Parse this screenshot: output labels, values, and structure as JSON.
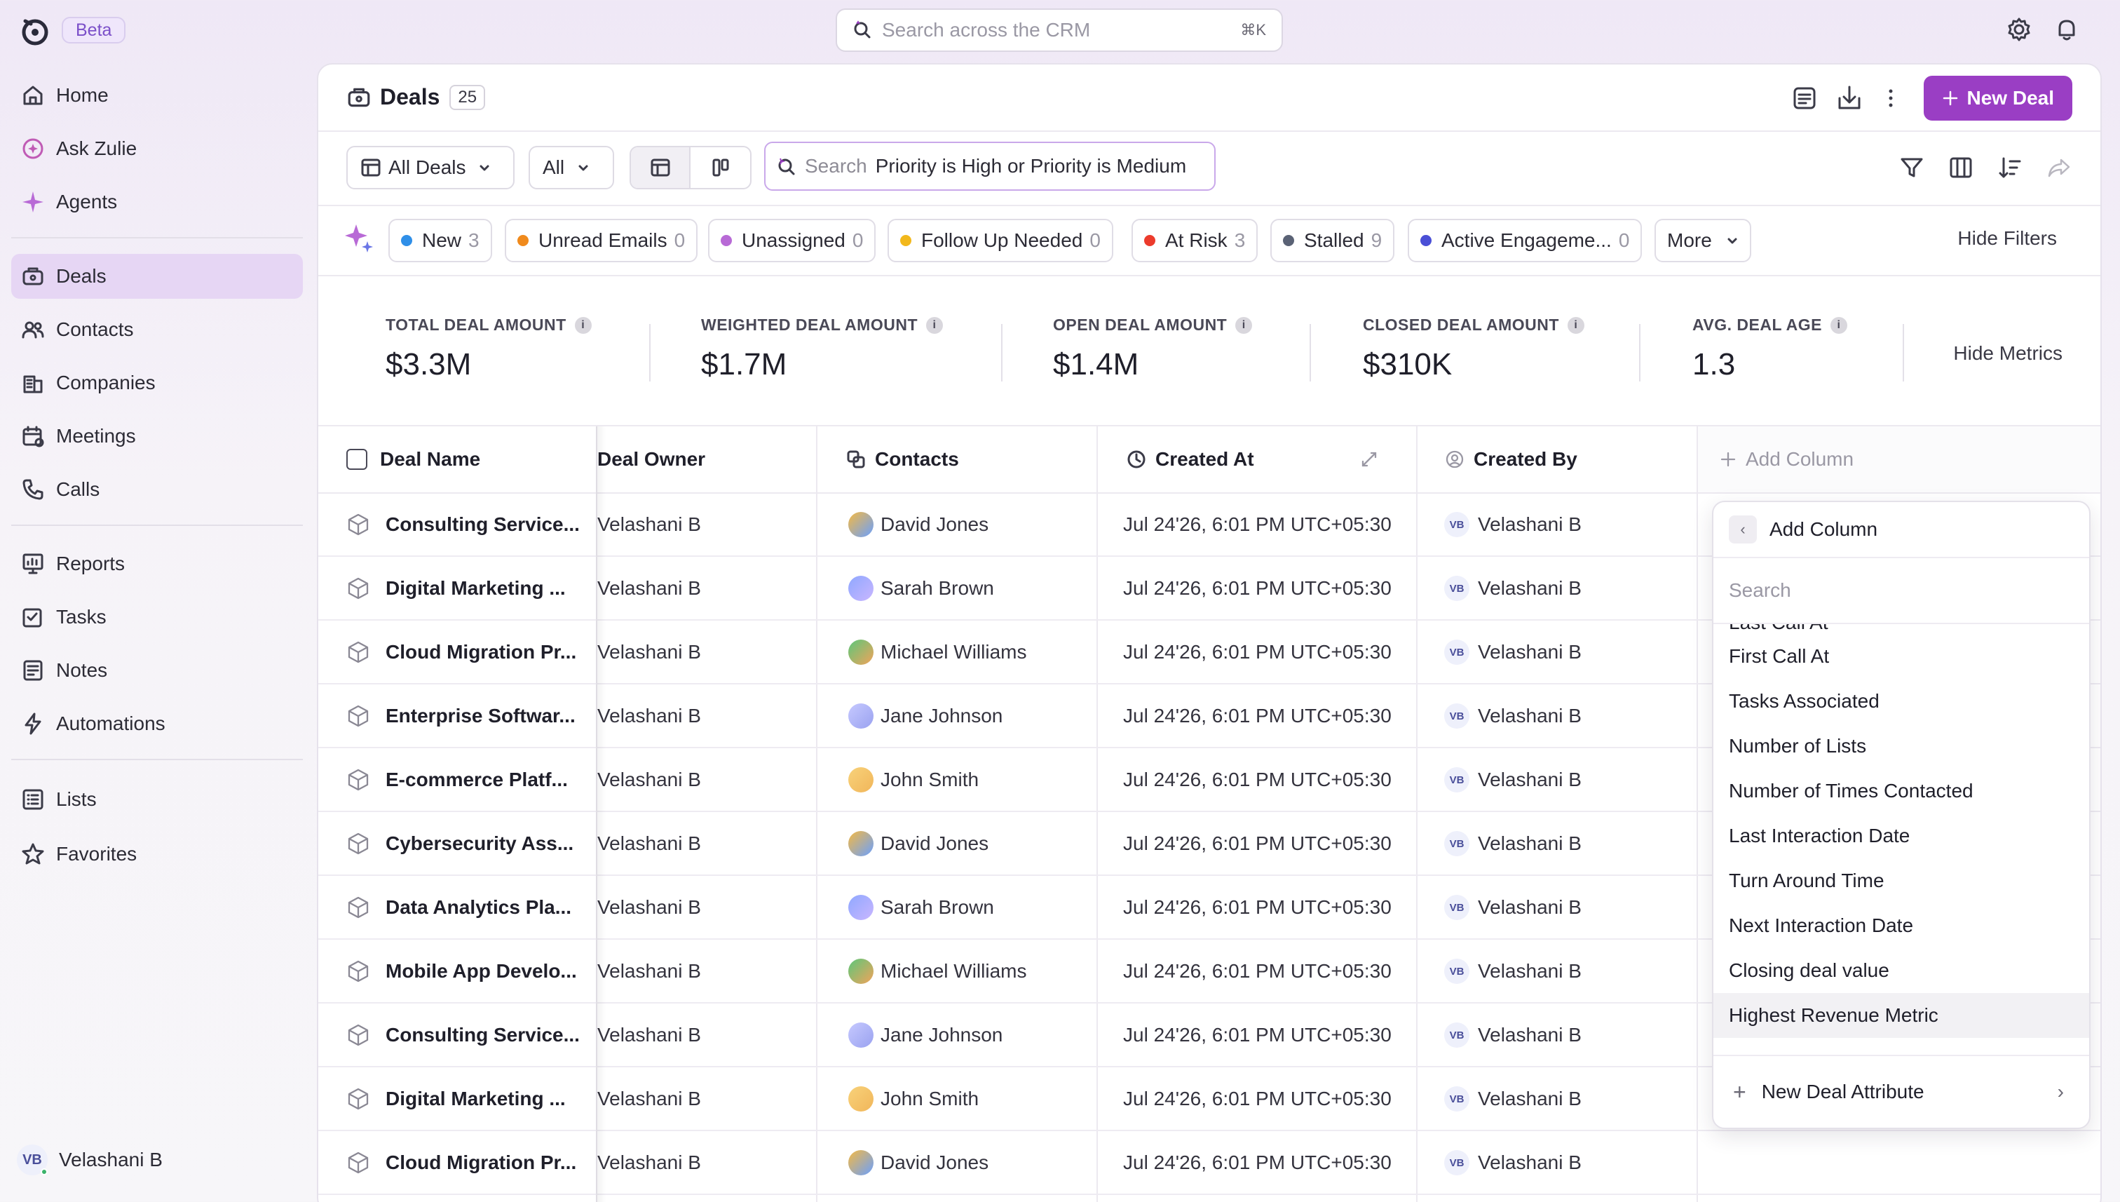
{
  "app": {
    "beta_badge": "Beta",
    "search_placeholder": "Search across the CRM",
    "search_shortcut": "⌘K"
  },
  "sidebar": {
    "items": [
      {
        "label": "Home",
        "icon": "home-icon"
      },
      {
        "label": "Ask Zulie",
        "icon": "ask-zulie-icon"
      },
      {
        "label": "Agents",
        "icon": "sparkle-icon"
      },
      {
        "label": "Deals",
        "icon": "deals-icon"
      },
      {
        "label": "Contacts",
        "icon": "contacts-icon"
      },
      {
        "label": "Companies",
        "icon": "building-icon"
      },
      {
        "label": "Meetings",
        "icon": "calendar-icon"
      },
      {
        "label": "Calls",
        "icon": "phone-icon"
      },
      {
        "label": "Reports",
        "icon": "report-icon"
      },
      {
        "label": "Tasks",
        "icon": "tasks-icon"
      },
      {
        "label": "Notes",
        "icon": "notes-icon"
      },
      {
        "label": "Automations",
        "icon": "bolt-icon"
      },
      {
        "label": "Lists",
        "icon": "list-icon"
      },
      {
        "label": "Favorites",
        "icon": "star-icon"
      }
    ],
    "active": "Deals",
    "user": {
      "initials": "VB",
      "name": "Velashani B"
    }
  },
  "header": {
    "title": "Deals",
    "count": "25",
    "new_deal_label": "New Deal"
  },
  "toolbar": {
    "view_select": "All Deals",
    "scope_select": "All",
    "search_label": "Search",
    "search_query": "Priority is High or Priority is Medium"
  },
  "chips": [
    {
      "label": "New",
      "count": "3",
      "color": "#2f8fe8"
    },
    {
      "label": "Unread Emails",
      "count": "0",
      "color": "#f08a1c"
    },
    {
      "label": "Unassigned",
      "count": "0",
      "color": "#b86ad6"
    },
    {
      "label": "Follow Up Needed",
      "count": "0",
      "color": "#f2b81c"
    },
    {
      "label": "At Risk",
      "count": "3",
      "color": "#ec3b2c"
    },
    {
      "label": "Stalled",
      "count": "9",
      "color": "#5a6275"
    },
    {
      "label": "Active Engageme...",
      "count": "0",
      "color": "#4a4fd6"
    }
  ],
  "more_label": "More",
  "hide_filters_label": "Hide Filters",
  "metrics": [
    {
      "label": "TOTAL DEAL AMOUNT",
      "value": "$3.3M"
    },
    {
      "label": "WEIGHTED DEAL AMOUNT",
      "value": "$1.7M"
    },
    {
      "label": "OPEN DEAL AMOUNT",
      "value": "$1.4M"
    },
    {
      "label": "CLOSED DEAL AMOUNT",
      "value": "$310K"
    },
    {
      "label": "AVG. DEAL AGE",
      "value": "1.3"
    }
  ],
  "hide_metrics_label": "Hide Metrics",
  "table": {
    "columns": [
      "Deal Name",
      "Deal Owner",
      "Contacts",
      "Created At",
      "Created By"
    ],
    "add_column_label": "Add Column",
    "rows": [
      {
        "name": "Consulting Service...",
        "owner": "Velashani B",
        "contact": "David Jones",
        "created_at": "Jul 24'26, 6:01 PM UTC+05:30",
        "created_by": "Velashani B"
      },
      {
        "name": "Digital Marketing ...",
        "owner": "Velashani B",
        "contact": "Sarah Brown",
        "created_at": "Jul 24'26, 6:01 PM UTC+05:30",
        "created_by": "Velashani B"
      },
      {
        "name": "Cloud Migration Pr...",
        "owner": "Velashani B",
        "contact": "Michael Williams",
        "created_at": "Jul 24'26, 6:01 PM UTC+05:30",
        "created_by": "Velashani B"
      },
      {
        "name": "Enterprise Softwar...",
        "owner": "Velashani B",
        "contact": "Jane Johnson",
        "created_at": "Jul 24'26, 6:01 PM UTC+05:30",
        "created_by": "Velashani B"
      },
      {
        "name": "E-commerce Platf...",
        "owner": "Velashani B",
        "contact": "John Smith",
        "created_at": "Jul 24'26, 6:01 PM UTC+05:30",
        "created_by": "Velashani B"
      },
      {
        "name": "Cybersecurity Ass...",
        "owner": "Velashani B",
        "contact": "David Jones",
        "created_at": "Jul 24'26, 6:01 PM UTC+05:30",
        "created_by": "Velashani B"
      },
      {
        "name": "Data Analytics Pla...",
        "owner": "Velashani B",
        "contact": "Sarah Brown",
        "created_at": "Jul 24'26, 6:01 PM UTC+05:30",
        "created_by": "Velashani B"
      },
      {
        "name": "Mobile App Develo...",
        "owner": "Velashani B",
        "contact": "Michael Williams",
        "created_at": "Jul 24'26, 6:01 PM UTC+05:30",
        "created_by": "Velashani B"
      },
      {
        "name": "Consulting Service...",
        "owner": "Velashani B",
        "contact": "Jane Johnson",
        "created_at": "Jul 24'26, 6:01 PM UTC+05:30",
        "created_by": "Velashani B"
      },
      {
        "name": "Digital Marketing ...",
        "owner": "Velashani B",
        "contact": "John Smith",
        "created_at": "Jul 24'26, 6:01 PM UTC+05:30",
        "created_by": "Velashani B"
      },
      {
        "name": "Cloud Migration Pr...",
        "owner": "Velashani B",
        "contact": "David Jones",
        "created_at": "Jul 24'26, 6:01 PM UTC+05:30",
        "created_by": "Velashani B"
      }
    ],
    "initials": "VB"
  },
  "add_column_popover": {
    "title": "Add Column",
    "search_placeholder": "Search",
    "cut_item": "Last Call At",
    "items": [
      "First Call At",
      "Tasks Associated",
      "Number of Lists",
      "Number of Times Contacted",
      "Last Interaction Date",
      "Turn Around Time",
      "Next Interaction Date",
      "Closing deal value",
      "Highest Revenue Metric"
    ],
    "highlighted": "Highest Revenue Metric",
    "footer_label": "New Deal Attribute"
  },
  "colors": {
    "accent": "#9a3ec4",
    "active_nav": "#e6d6f4"
  }
}
